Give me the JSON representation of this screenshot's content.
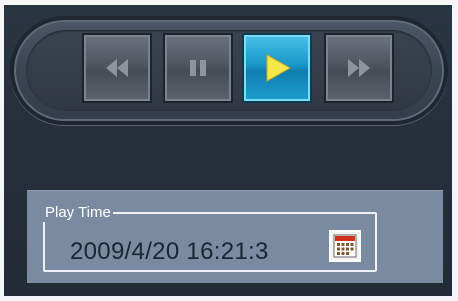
{
  "player": {
    "controls": [
      {
        "name": "rewind",
        "icon": "rewind-icon",
        "active": false
      },
      {
        "name": "pause",
        "icon": "pause-icon",
        "active": false
      },
      {
        "name": "play",
        "icon": "play-icon",
        "active": true
      },
      {
        "name": "fast-forward",
        "icon": "fast-forward-icon",
        "active": false
      }
    ],
    "accent_color": "#1a97c9",
    "play_icon_color": "#f5e84a"
  },
  "play_time": {
    "label": "Play Time",
    "value": "2009/4/20 16:21:3",
    "calendar_icon": "calendar-icon"
  }
}
